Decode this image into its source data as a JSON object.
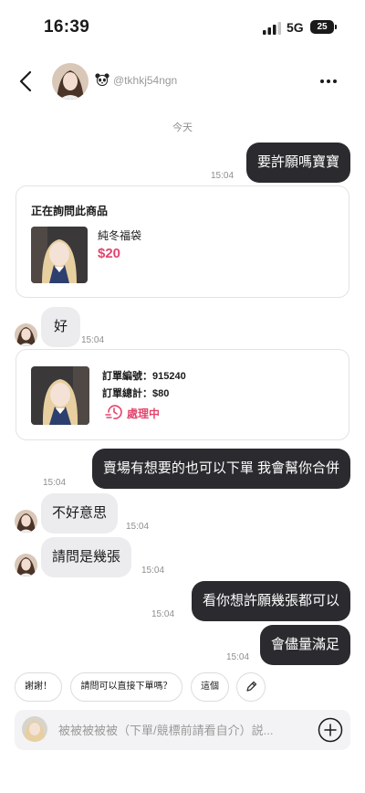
{
  "status_bar": {
    "time": "16:39",
    "network": "5G",
    "battery": "25"
  },
  "header": {
    "username": "@tkhkj54ngn"
  },
  "date_divider": "今天",
  "messages": [
    {
      "type": "out",
      "text": "要許願嗎寶寶",
      "time": "15:04"
    },
    {
      "type": "product_card",
      "title": "正在詢問此商品",
      "product_name": "純冬福袋",
      "price": "$20"
    },
    {
      "type": "in",
      "text": "好",
      "time": "15:04"
    },
    {
      "type": "order_card",
      "order_no": "訂單編號：915240",
      "order_total": "訂單總計：$80",
      "status": "處理中"
    },
    {
      "type": "out",
      "text": "賣場有想要的也可以下單 我會幫你合併",
      "time": "15:04"
    },
    {
      "type": "in",
      "text": "不好意思",
      "time": "15:04"
    },
    {
      "type": "in",
      "text": "請問是幾張",
      "time": "15:04"
    },
    {
      "type": "out",
      "text": "看你想許願幾張都可以",
      "time": "15:04"
    },
    {
      "type": "out",
      "text": "會儘量滿足",
      "time": "15:04"
    }
  ],
  "quick_replies": [
    "謝謝！",
    "請問可以直接下單嗎？",
    "這個"
  ],
  "composer": {
    "placeholder": "被被被被被（下單/競標前請看自介）説..."
  },
  "colors": {
    "accent": "#e2456d",
    "bubble_out": "#2b2b2f",
    "bubble_in": "#ececef"
  },
  "icons": [
    "back-arrow-icon",
    "panda-icon",
    "more-icon",
    "clock-icon",
    "pencil-icon",
    "plus-icon"
  ]
}
